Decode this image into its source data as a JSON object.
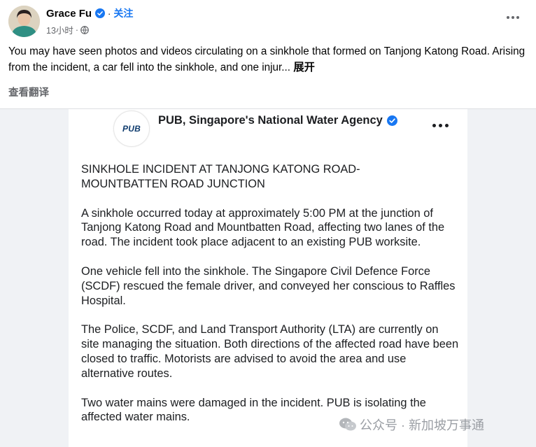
{
  "post": {
    "author": "Grace Fu",
    "separator": "·",
    "follow_label": "关注",
    "timestamp": "13小时",
    "meta_separator": "·",
    "text": "You may have seen photos and videos circulating on a sinkhole that formed on Tanjong Katong Road. Arising from the incident, a car fell into the sinkhole, and one injur...",
    "see_more_label": "展开",
    "translate_label": "查看翻译",
    "icons": [
      "verified-badge-icon",
      "globe-icon",
      "more-options-icon"
    ],
    "colors": {
      "link": "#1877f2",
      "muted": "#65676b",
      "text": "#050505"
    }
  },
  "shared_image": {
    "page_name": "PUB, Singapore's National Water Agency",
    "logo_text": "PUB",
    "headline_line1": "SINKHOLE INCIDENT AT TANJONG KATONG ROAD-",
    "headline_line2": "MOUNTBATTEN ROAD JUNCTION",
    "paragraphs": [
      "A sinkhole occurred today at approximately 5:00 PM at the junction of Tanjong Katong Road and Mountbatten Road, affecting two lanes of the road. The incident took place adjacent to an existing PUB worksite.",
      "One vehicle fell into the sinkhole. The Singapore Civil Defence Force (SCDF) rescued the female driver, and conveyed her conscious to Raffles Hospital.",
      "The Police, SCDF, and Land Transport Authority (LTA) are currently on site managing the situation. Both directions of the affected road have been closed to traffic. Motorists are advised to avoid the area and use alternative routes.",
      "Two water mains were damaged in the incident. PUB is isolating the affected water mains."
    ]
  },
  "watermark": {
    "text": "公众号 · 新加坡万事通"
  }
}
